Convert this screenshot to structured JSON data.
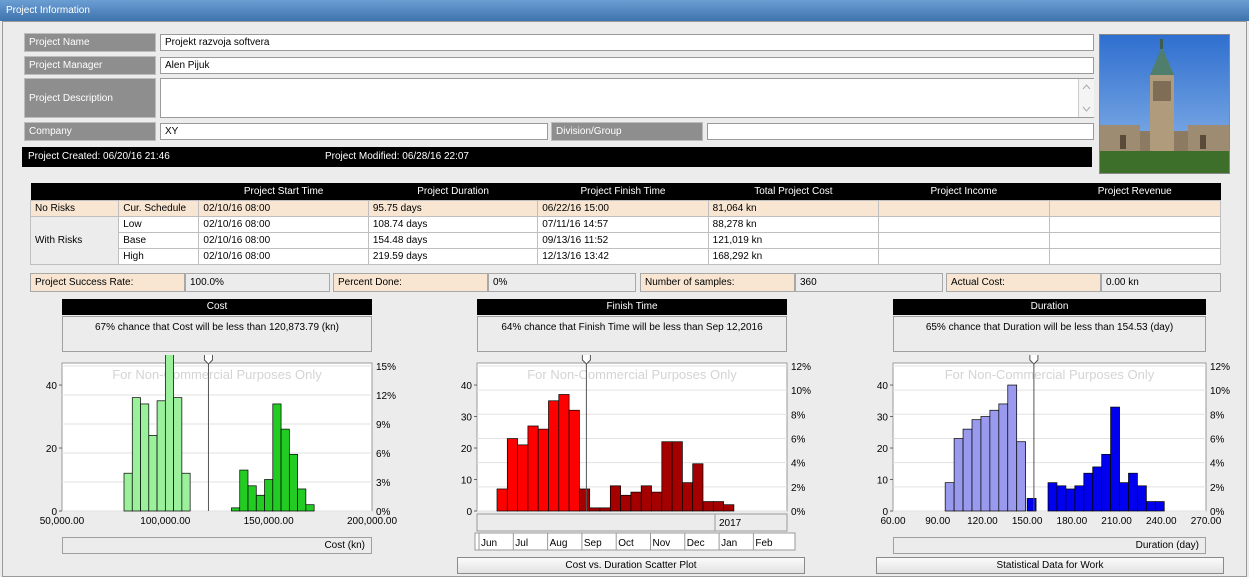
{
  "window": {
    "title": "Project Information"
  },
  "form": {
    "project_name_label": "Project Name",
    "project_name_value": "Projekt razvoja softvera",
    "project_manager_label": "Project Manager",
    "project_manager_value": "Alen Pijuk",
    "project_description_label": "Project Description",
    "project_description_value": "",
    "company_label": "Company",
    "company_value": "XY",
    "division_label": "Division/Group",
    "division_value": ""
  },
  "status": {
    "created": "Project Created: 06/20/16 21:46",
    "modified": "Project Modified: 06/28/16 22:07"
  },
  "summary": {
    "headers": [
      "",
      "",
      "Project Start Time",
      "Project Duration",
      "Project Finish Time",
      "Total Project Cost",
      "Project Income",
      "Project Revenue"
    ],
    "rows": [
      {
        "group": "No Risks",
        "type": "Cur. Schedule",
        "start": "02/10/16 08:00",
        "duration": "95.75 days",
        "finish": "06/22/16 15:00",
        "cost": "81,064 kn",
        "income": "",
        "revenue": ""
      },
      {
        "group": "",
        "type": "Low",
        "start": "02/10/16 08:00",
        "duration": "108.74 days",
        "finish": "07/11/16 14:57",
        "cost": "88,278 kn",
        "income": "",
        "revenue": ""
      },
      {
        "group": "With Risks",
        "type": "Base",
        "start": "02/10/16 08:00",
        "duration": "154.48 days",
        "finish": "09/13/16 11:52",
        "cost": "121,019 kn",
        "income": "",
        "revenue": ""
      },
      {
        "group": "",
        "type": "High",
        "start": "02/10/16 08:00",
        "duration": "219.59 days",
        "finish": "12/13/16 13:42",
        "cost": "168,292 kn",
        "income": "",
        "revenue": ""
      }
    ]
  },
  "stats": {
    "success_label": "Project Success Rate:",
    "success_value": "100.0%",
    "percent_label": "Percent Done:",
    "percent_value": "0%",
    "samples_label": "Number of samples:",
    "samples_value": "360",
    "actual_label": "Actual Cost:",
    "actual_value": "0.00 kn"
  },
  "charts": {
    "watermark": "For Non-Commercial Purposes Only",
    "cost": {
      "title": "Cost",
      "desc": "67% chance that Cost will be less than 120,873.79 (kn)",
      "axis_title": "Cost (kn)"
    },
    "finish": {
      "title": "Finish Time",
      "desc": "64% chance that Finish Time will be less than Sep 12,2016",
      "year_label": "2017"
    },
    "duration": {
      "title": "Duration",
      "desc": "65% chance that Duration will be less than 154.53 (day)",
      "axis_title": "Duration (day)"
    }
  },
  "buttons": {
    "scatter": "Cost vs. Duration Scatter Plot",
    "statistical": "Statistical Data for Work"
  },
  "colors": {
    "cost_low": "#9bf09b",
    "cost_high": "#22cc22",
    "finish_low": "#ff0000",
    "finish_high": "#a50000",
    "duration_low": "#9999ee",
    "duration_high": "#0000ee"
  },
  "chart_data": [
    {
      "type": "bar",
      "title": "Cost",
      "xlabel": "Cost (kn)",
      "xlim": [
        50000,
        200000
      ],
      "ylim": [
        0,
        47
      ],
      "y_right_ticks": [
        "0%",
        "3%",
        "6%",
        "9%",
        "12%",
        "15%"
      ],
      "x_tick_labels": [
        "50,000.00",
        "100,000.00",
        "150,000.00",
        "200,000.00"
      ],
      "y_tick_labels": [
        "0",
        "20",
        "40"
      ],
      "marker_x": 120873.79,
      "series": [
        {
          "name": "low",
          "bins": [
            [
              80000,
              12
            ],
            [
              84000,
              36
            ],
            [
              88000,
              34
            ],
            [
              92000,
              24
            ],
            [
              96000,
              35
            ],
            [
              100000,
              50
            ],
            [
              104000,
              36
            ],
            [
              108000,
              12
            ]
          ]
        },
        {
          "name": "high",
          "bins": [
            [
              132000,
              1
            ],
            [
              136000,
              13
            ],
            [
              140000,
              8
            ],
            [
              144000,
              5
            ],
            [
              148000,
              10
            ],
            [
              152000,
              34
            ],
            [
              156000,
              26
            ],
            [
              160000,
              18
            ],
            [
              164000,
              7
            ],
            [
              168000,
              2
            ]
          ]
        }
      ]
    },
    {
      "type": "bar",
      "title": "Finish Time",
      "ylim": [
        0,
        47
      ],
      "y_right_ticks": [
        "0%",
        "2%",
        "4%",
        "6%",
        "8%",
        "10%",
        "12%"
      ],
      "y_tick_labels": [
        "0",
        "10",
        "20",
        "30",
        "40"
      ],
      "x_tick_labels": [
        "Jun",
        "Jul",
        "Aug",
        "Sep",
        "Oct",
        "Nov",
        "Dec",
        "Jan",
        "Feb"
      ],
      "series": [
        {
          "name": "low",
          "values": [
            7,
            23,
            21,
            27,
            26,
            35,
            37,
            32
          ]
        },
        {
          "name": "high",
          "values": [
            7,
            1,
            1,
            8,
            5,
            6,
            8,
            6,
            22,
            22,
            9,
            15,
            3,
            3,
            2
          ]
        }
      ]
    },
    {
      "type": "bar",
      "title": "Duration",
      "xlabel": "Duration (day)",
      "xlim": [
        60,
        270
      ],
      "ylim": [
        0,
        47
      ],
      "y_right_ticks": [
        "0%",
        "2%",
        "4%",
        "6%",
        "8%",
        "10%",
        "12%"
      ],
      "x_tick_labels": [
        "60.00",
        "90.00",
        "120.00",
        "150.00",
        "180.00",
        "210.00",
        "240.00",
        "270.00"
      ],
      "y_tick_labels": [
        "0",
        "10",
        "20",
        "30",
        "40"
      ],
      "marker_x": 154.53,
      "series": [
        {
          "name": "low",
          "bins": [
            [
              95,
              9
            ],
            [
              101,
              23
            ],
            [
              107,
              26
            ],
            [
              113,
              29
            ],
            [
              119,
              30
            ],
            [
              125,
              32
            ],
            [
              131,
              34
            ],
            [
              137,
              40
            ],
            [
              143,
              22
            ]
          ]
        },
        {
          "name": "high",
          "bins": [
            [
              150,
              4
            ],
            [
              164,
              9
            ],
            [
              170,
              8
            ],
            [
              176,
              7
            ],
            [
              182,
              8
            ],
            [
              188,
              12
            ],
            [
              194,
              14
            ],
            [
              200,
              18
            ],
            [
              206,
              33
            ],
            [
              212,
              9
            ],
            [
              218,
              12
            ],
            [
              224,
              8
            ],
            [
              230,
              3
            ],
            [
              236,
              3
            ]
          ]
        }
      ]
    }
  ]
}
